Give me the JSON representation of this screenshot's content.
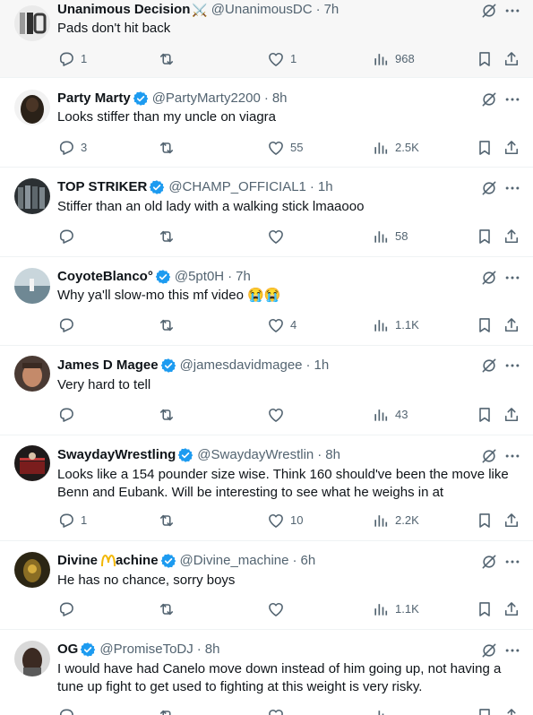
{
  "tweets": [
    {
      "name": "Unanimous Decision",
      "name_emoji": "⚔️",
      "verified": false,
      "handle": "@UnanimousDC",
      "time": "7h",
      "text": "Pads don't hit back",
      "replies": "1",
      "retweets": "",
      "likes": "1",
      "views": "968",
      "highlighted": true,
      "avatar_color": "#e9e9e9"
    },
    {
      "name": "Party Marty",
      "verified": true,
      "handle": "@PartyMarty2200",
      "time": "8h",
      "text": "Looks stiffer than my uncle on viagra",
      "replies": "3",
      "retweets": "",
      "likes": "55",
      "views": "2.5K",
      "avatar_color": "#2a2118"
    },
    {
      "name": "TOP STRIKER",
      "verified": true,
      "handle": "@CHAMP_OFFICIAL1",
      "time": "1h",
      "text": "Stiffer than an old lady with a walking stick lmaaooo",
      "replies": "",
      "retweets": "",
      "likes": "",
      "views": "58",
      "avatar_color": "#3c4347"
    },
    {
      "name": "CoyoteBlanco°",
      "verified": true,
      "handle": "@5pt0H",
      "time": "7h",
      "text": "Why ya'll slow-mo this mf video 😭😭",
      "replies": "",
      "retweets": "",
      "likes": "4",
      "views": "1.1K",
      "avatar_color": "#8fa3ad"
    },
    {
      "name": "James D Magee",
      "verified": true,
      "handle": "@jamesdavidmagee",
      "time": "1h",
      "text": "Very hard to tell",
      "replies": "",
      "retweets": "",
      "likes": "",
      "views": "43",
      "avatar_color": "#9a6a52"
    },
    {
      "name": "SwaydayWrestling",
      "verified": true,
      "handle": "@SwaydayWrestlin",
      "time": "8h",
      "text": "Looks like a 154 pounder size wise. Think 160 should've been the move like Benn and Eubank. Will be interesting to see what he weighs in at",
      "replies": "1",
      "retweets": "",
      "likes": "10",
      "views": "2.2K",
      "avatar_color": "#1f1a1a"
    },
    {
      "name_a": "Divine",
      "name_b": "achine",
      "verified": true,
      "handle": "@Divine_machine",
      "time": "6h",
      "text": "He has no chance,  sorry boys",
      "replies": "",
      "retweets": "",
      "likes": "",
      "views": "1.1K",
      "avatar_color": "#5a4a1e"
    },
    {
      "name": "OG",
      "verified": true,
      "handle": "@PromiseToDJ",
      "time": "8h",
      "text": "I would have had Canelo move down instead of him going up, not having a tune up fight to get used to fighting at this weight is very risky.",
      "replies": "",
      "retweets": "",
      "likes": "",
      "views": "",
      "avatar_color": "#3b2a22"
    }
  ],
  "colors": {
    "verified": "#1d9bf0",
    "secondary": "#536471",
    "primary": "#0f1419"
  },
  "icons": [
    "reply-icon",
    "retweet-icon",
    "like-icon",
    "views-icon",
    "bookmark-icon",
    "share-icon",
    "translate-icon",
    "more-icon",
    "verified-badge-icon"
  ]
}
